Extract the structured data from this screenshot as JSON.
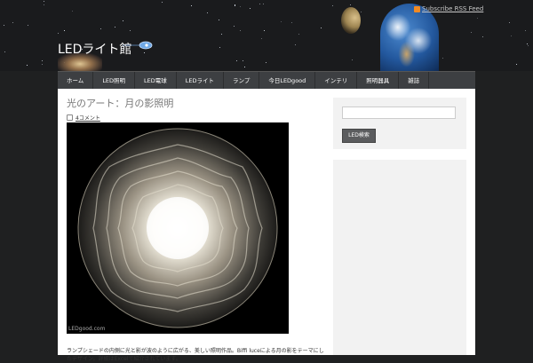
{
  "header": {
    "site_title": "LEDライト館",
    "rss_label": "Subscribe RSS Feed"
  },
  "nav": {
    "items": [
      "ホーム",
      "LED照明",
      "LED電球",
      "LEDライト",
      "ランプ",
      "今日LEDgood",
      "インテリ",
      "照明器具",
      "雑誌"
    ]
  },
  "post": {
    "title": "光のアート：月の影照明",
    "comments": "4コメント",
    "image_watermark": "LEDgood.com",
    "excerpt": "ランプシェードの内側に光と影が波のように広がる、美しい照明作品。Biffi luceによる月の影をテーマにしたデザイン。詳細はExcelで紹介されています。"
  },
  "sidebar": {
    "search_placeholder": "",
    "search_button": "LED検索"
  },
  "icons": {
    "rss": "rss-icon",
    "comment": "comment-icon"
  },
  "colors": {
    "background": "#1f2021",
    "nav": "#3d3f42",
    "accent_rss": "#f08a24"
  }
}
